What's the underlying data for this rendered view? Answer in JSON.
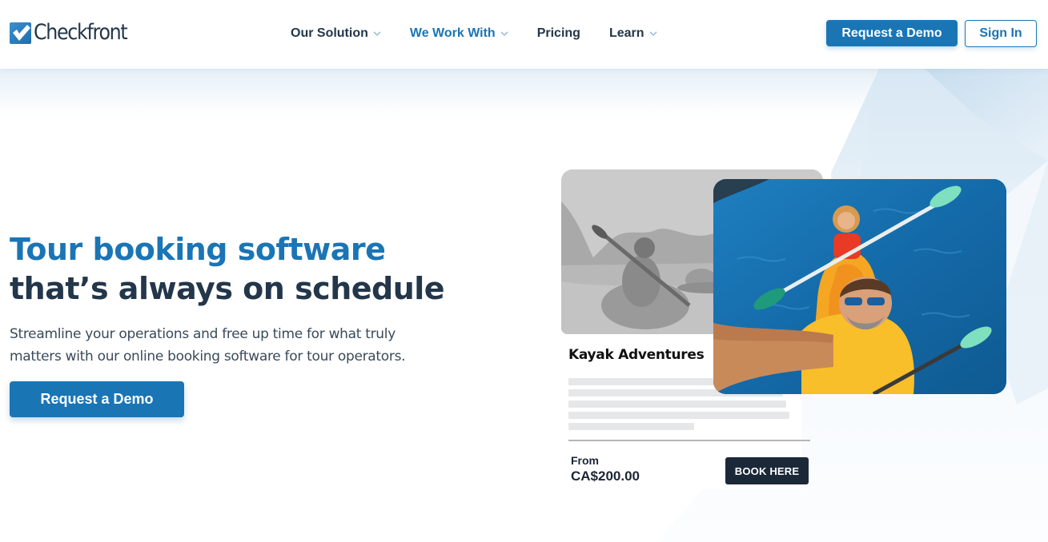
{
  "header": {
    "logo_text": "Checkfront",
    "nav": [
      {
        "label": "Our Solution",
        "has_dropdown": true,
        "active": false
      },
      {
        "label": "We Work With",
        "has_dropdown": true,
        "active": true
      },
      {
        "label": "Pricing",
        "has_dropdown": false,
        "active": false
      },
      {
        "label": "Learn",
        "has_dropdown": true,
        "active": false
      }
    ],
    "request_demo_label": "Request a Demo",
    "sign_in_label": "Sign In"
  },
  "hero": {
    "title_line1": "Tour booking software",
    "title_line2": "that’s always on schedule",
    "subtitle": "Streamline your operations and free up time for what truly matters with our online booking software for tour operators.",
    "cta_label": "Request a Demo"
  },
  "product_card": {
    "image_alt": "kayakers-grayscale-photo",
    "title": "Kayak Adventures",
    "from_label": "From",
    "price": "CA$200.00",
    "book_label": "BOOK HERE"
  },
  "feature_photo": {
    "image_alt": "couple-kayaking-selfie-photo"
  },
  "colors": {
    "brand_blue": "#1a75b5",
    "dark_navy": "#23364a",
    "book_button": "#1b2838"
  }
}
